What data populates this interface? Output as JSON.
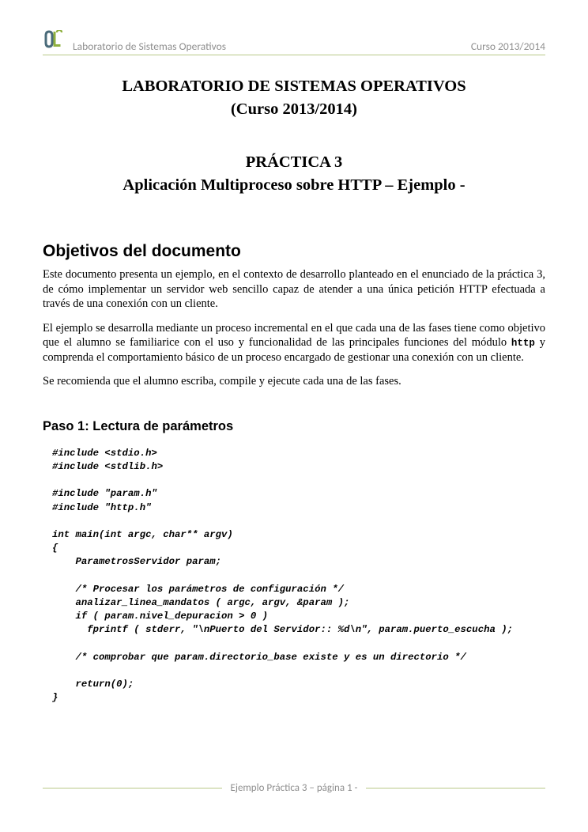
{
  "header": {
    "left_text": "Laboratorio de Sistemas Operativos",
    "right_text": "Curso 2013/2014"
  },
  "title": {
    "line1": "LABORATORIO DE SISTEMAS OPERATIVOS",
    "line2": "(Curso 2013/2014)",
    "practice_num": "PRÁCTICA 3",
    "practice_title": "Aplicación Multiproceso sobre HTTP – Ejemplo -"
  },
  "section": {
    "heading": "Objetivos del documento",
    "p1": "Este documento presenta un ejemplo, en el contexto de desarrollo planteado en el enunciado de la práctica 3, de cómo implementar un servidor web sencillo capaz de atender a una única petición HTTP efectuada a través de una conexión con un cliente.",
    "p2a": "El ejemplo se desarrolla mediante un proceso incremental en el que cada una de las fases tiene como objetivo que el alumno se familiarice con el uso y funcionalidad de las principales funciones del módulo ",
    "p2_mono": "http",
    "p2b": " y comprenda el comportamiento básico de un proceso encargado de gestionar una conexión con un cliente.",
    "p3": "Se recomienda que el alumno escriba, compile y ejecute cada una de las fases."
  },
  "step1": {
    "heading": "Paso 1: Lectura de parámetros",
    "code": "#include <stdio.h>\n#include <stdlib.h>\n\n#include \"param.h\"\n#include \"http.h\"\n\nint main(int argc, char** argv)\n{\n    ParametrosServidor param;\n\n    /* Procesar los parámetros de configuración */\n    analizar_linea_mandatos ( argc, argv, &param );\n    if ( param.nivel_depuracion > 0 )\n      fprintf ( stderr, \"\\nPuerto del Servidor:: %d\\n\", param.puerto_escucha );\n\n    /* comprobar que param.directorio_base existe y es un directorio */\n\n    return(0);\n}"
  },
  "footer": {
    "text": "Ejemplo Práctica 3 – página 1 -"
  }
}
